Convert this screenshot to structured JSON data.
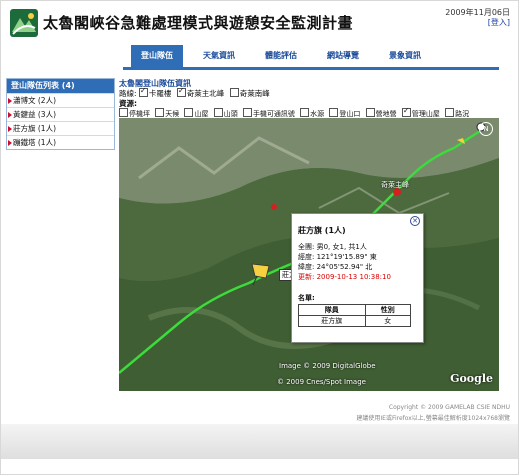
{
  "header": {
    "title": "太魯閣峽谷急難處理模式與遊憩安全監測計畫",
    "date": "2009年11月06日",
    "login": "[登入]"
  },
  "nav": {
    "items": [
      "登山隊伍",
      "天氣資訊",
      "體能評估",
      "網站導覽",
      "景象資訊"
    ],
    "active": 0
  },
  "sidebar": {
    "header": "登山隊伍列表 (4)",
    "items": [
      {
        "label": "瀟博文 (2人)"
      },
      {
        "label": "黃鍵益 (3人)"
      },
      {
        "label": "莊方旗 (1人)"
      },
      {
        "label": "蹦鐵塔 (1人)"
      }
    ]
  },
  "panel": {
    "title": "太魯閣登山隊伍資訊",
    "routes_label": "路線:",
    "routes": [
      {
        "label": "卡羅樓",
        "checked": true
      },
      {
        "label": "奇萊主北峰",
        "checked": true
      },
      {
        "label": "奇萊南峰",
        "checked": false
      }
    ],
    "resources_label": "資源:",
    "resources": [
      {
        "label": "停機坪",
        "checked": false
      },
      {
        "label": "天候",
        "checked": false
      },
      {
        "label": "山屋",
        "checked": false
      },
      {
        "label": "山頭",
        "checked": false
      },
      {
        "label": "手機可通訊號",
        "checked": false
      },
      {
        "label": "水源",
        "checked": false
      },
      {
        "label": "登山口",
        "checked": false
      },
      {
        "label": "營地營",
        "checked": false
      },
      {
        "label": "管理山屋",
        "checked": true
      },
      {
        "label": "路況",
        "checked": false
      }
    ]
  },
  "popup": {
    "title": "莊方旗 (1人)",
    "total": "全團: 男0, 女1, 共1人",
    "longitude": "經度: 121°19'15.89\" 東",
    "latitude": "緯度: 24°05'52.94\" 北",
    "updated": "更新: 2009-10-13 10:38:10",
    "members_label": "名單:",
    "columns": [
      "隊員",
      "性別"
    ],
    "rows": [
      [
        "莊方旗",
        "女"
      ]
    ]
  },
  "map": {
    "name_tag": "莊方旗",
    "label_peak": "奇萊主峰",
    "credit1": "Image © 2009 DigitalGlobe",
    "credit2": "© 2009 Cnes/Spot Image",
    "logo": "Google",
    "compass": "N"
  },
  "footer": {
    "copyright": "Copyright © 2009 GAMELAB CSIE NDHU",
    "hint": "建議使用IE或Firefox以上,螢幕最佳解析度1024x768瀏覽"
  },
  "colors": {
    "accent": "#2f6db7",
    "route": "#3cdc3c",
    "update": "#dd0000"
  }
}
